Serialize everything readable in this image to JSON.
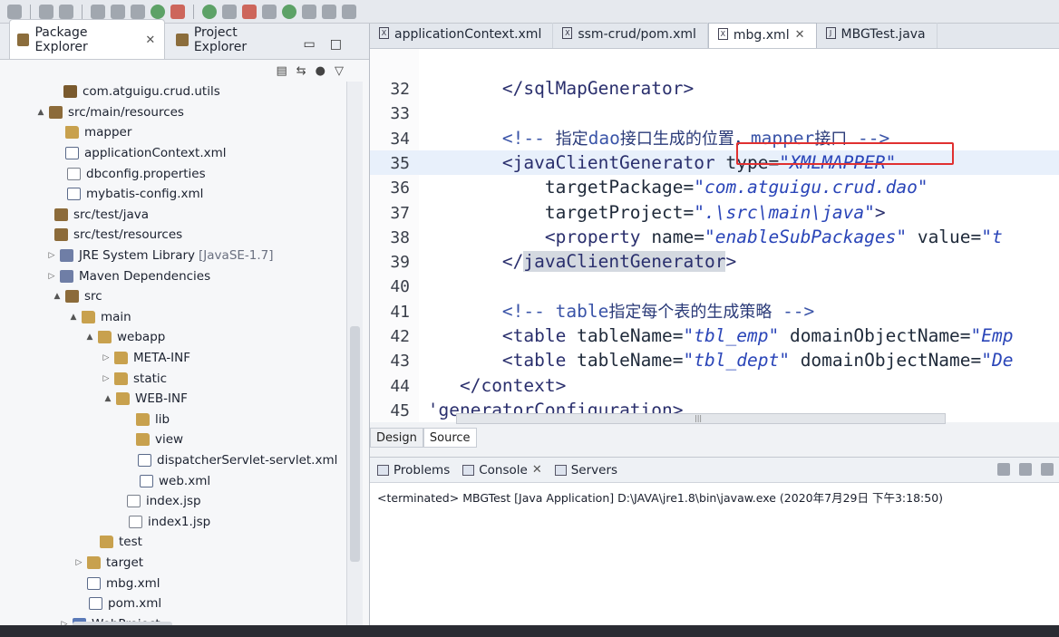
{
  "left_panel": {
    "tabs": [
      {
        "label": "Package Explorer",
        "active": true
      },
      {
        "label": "Project Explorer",
        "active": false
      }
    ],
    "tree": [
      {
        "label": "com.atguigu.crud.utils",
        "indent": 56,
        "arrow": "",
        "icon": "pkg",
        "extra": ""
      },
      {
        "label": "src/main/resources",
        "indent": 40,
        "arrow": "▲",
        "icon": "srcfolder",
        "extra": ""
      },
      {
        "label": "mapper",
        "indent": 58,
        "arrow": "",
        "icon": "folder",
        "extra": ""
      },
      {
        "label": "applicationContext.xml",
        "indent": 58,
        "arrow": "",
        "icon": "xml",
        "extra": ""
      },
      {
        "label": "dbconfig.properties",
        "indent": 60,
        "arrow": "",
        "icon": "file",
        "extra": ""
      },
      {
        "label": "mybatis-config.xml",
        "indent": 60,
        "arrow": "",
        "icon": "xml",
        "extra": ""
      },
      {
        "label": "src/test/java",
        "indent": 46,
        "arrow": "",
        "icon": "srcfolder",
        "extra": ""
      },
      {
        "label": "src/test/resources",
        "indent": 46,
        "arrow": "",
        "icon": "srcfolder",
        "extra": ""
      },
      {
        "label": "JRE System Library",
        "indent": 52,
        "arrow": "▷",
        "icon": "lib",
        "extra": "[JavaSE-1.7]"
      },
      {
        "label": "Maven Dependencies",
        "indent": 52,
        "arrow": "▷",
        "icon": "lib",
        "extra": ""
      },
      {
        "label": "src",
        "indent": 58,
        "arrow": "▲",
        "icon": "srcfolder",
        "extra": ""
      },
      {
        "label": "main",
        "indent": 76,
        "arrow": "▲",
        "icon": "folder",
        "extra": ""
      },
      {
        "label": "webapp",
        "indent": 94,
        "arrow": "▲",
        "icon": "folder",
        "extra": ""
      },
      {
        "label": "META-INF",
        "indent": 112,
        "arrow": "▷",
        "icon": "folder",
        "extra": ""
      },
      {
        "label": "static",
        "indent": 112,
        "arrow": "▷",
        "icon": "folder",
        "extra": ""
      },
      {
        "label": "WEB-INF",
        "indent": 114,
        "arrow": "▲",
        "icon": "folder",
        "extra": ""
      },
      {
        "label": "lib",
        "indent": 136,
        "arrow": "",
        "icon": "folder",
        "extra": ""
      },
      {
        "label": "view",
        "indent": 136,
        "arrow": "",
        "icon": "folder",
        "extra": ""
      },
      {
        "label": "dispatcherServlet-servlet.xml",
        "indent": 138,
        "arrow": "",
        "icon": "xml",
        "extra": ""
      },
      {
        "label": "web.xml",
        "indent": 140,
        "arrow": "",
        "icon": "xml",
        "extra": ""
      },
      {
        "label": "index.jsp",
        "indent": 126,
        "arrow": "",
        "icon": "file",
        "extra": ""
      },
      {
        "label": "index1.jsp",
        "indent": 128,
        "arrow": "",
        "icon": "file",
        "extra": ""
      },
      {
        "label": "test",
        "indent": 96,
        "arrow": "",
        "icon": "folder",
        "extra": ""
      },
      {
        "label": "target",
        "indent": 82,
        "arrow": "▷",
        "icon": "folder",
        "extra": ""
      },
      {
        "label": "mbg.xml",
        "indent": 82,
        "arrow": "",
        "icon": "xml",
        "extra": ""
      },
      {
        "label": "pom.xml",
        "indent": 84,
        "arrow": "",
        "icon": "xml",
        "extra": ""
      },
      {
        "label": "WebProject",
        "indent": 66,
        "arrow": "▷",
        "icon": "proj",
        "extra": ""
      }
    ]
  },
  "editor": {
    "tabs": [
      {
        "label": "applicationContext.xml",
        "active": false
      },
      {
        "label": "ssm-crud/pom.xml",
        "active": false
      },
      {
        "label": "mbg.xml",
        "active": true
      },
      {
        "label": "MBGTest.java",
        "active": false
      }
    ],
    "lines": [
      {
        "num": "32",
        "html": "        <span class=\"tag\">&lt;/sqlMapGenerator&gt;</span>"
      },
      {
        "num": "33",
        "html": ""
      },
      {
        "num": "34",
        "html": "        <span class=\"comment\">&lt;!-- </span><span class=\"cn\">指定</span><span class=\"comment\">dao</span><span class=\"cn\">接口生成的位置，</span><span class=\"comment\">mapper</span><span class=\"cn\">接口</span><span class=\"comment\"> --&gt;</span>"
      },
      {
        "num": "35",
        "html": "        <span class=\"tag\">&lt;javaClientGenerator</span> <span class=\"attr\">type=</span><span class=\"val\">\"XMLMAPPER\"</span>"
      },
      {
        "num": "36",
        "html": "            <span class=\"attr\">targetPackage=</span><span class=\"val\">\"com.atguigu.crud.dao\"</span>"
      },
      {
        "num": "37",
        "html": "            <span class=\"attr\">targetProject=</span><span class=\"val\">\".\\src\\main\\java\"</span><span class=\"tag\">&gt;</span>"
      },
      {
        "num": "38",
        "html": "            <span class=\"tag\">&lt;property</span> <span class=\"attr\">name=</span><span class=\"val\">\"enableSubPackages\"</span> <span class=\"attr\">value=</span><span class=\"val\">\"t</span>"
      },
      {
        "num": "39",
        "html": "        <span class=\"tag\">&lt;/</span><span class=\"tag hltag\">javaClientGenerator</span><span class=\"tag\">&gt;</span>"
      },
      {
        "num": "40",
        "html": ""
      },
      {
        "num": "41",
        "html": "        <span class=\"comment\">&lt;!-- table</span><span class=\"cn\">指定每个表的生成策略</span><span class=\"comment\"> --&gt;</span>"
      },
      {
        "num": "42",
        "html": "        <span class=\"tag\">&lt;table</span> <span class=\"attr\">tableName=</span><span class=\"val\">\"tbl_emp\"</span> <span class=\"attr\">domainObjectName=</span><span class=\"val\">\"Emp</span>"
      },
      {
        "num": "43",
        "html": "        <span class=\"tag\">&lt;table</span> <span class=\"attr\">tableName=</span><span class=\"val\">\"tbl_dept\"</span> <span class=\"attr\">domainObjectName=</span><span class=\"val\">\"De</span>"
      },
      {
        "num": "44",
        "html": "    <span class=\"tag\">&lt;/context&gt;</span>"
      },
      {
        "num": "45",
        "html": " <span class=\"tag\">'generatorConfiguration&gt;</span>"
      }
    ],
    "bottom_tabs": {
      "design": "Design",
      "source": "Source"
    }
  },
  "console": {
    "tabs": [
      "Problems",
      "Console",
      "Servers"
    ],
    "terminated_text": "<terminated> MBGTest [Java Application] D:\\JAVA\\jre1.8\\bin\\javaw.exe (2020年7月29日 下午3:18:50)"
  }
}
